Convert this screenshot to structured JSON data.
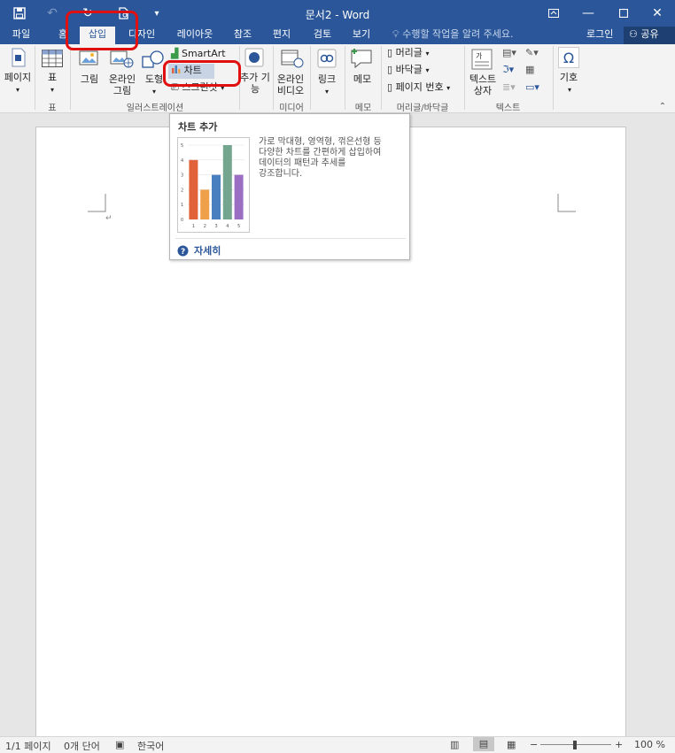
{
  "window": {
    "title": "문서2 - Word",
    "controls": [
      "restore-ribbon",
      "minimize",
      "maximize",
      "close"
    ]
  },
  "qat": [
    "save-icon",
    "undo-icon",
    "redo-icon",
    "print-preview-icon",
    "customize-icon"
  ],
  "tabs": [
    {
      "label": "파일"
    },
    {
      "label": "홈"
    },
    {
      "label": "삽입"
    },
    {
      "label": "디자인"
    },
    {
      "label": "레이아웃"
    },
    {
      "label": "참조"
    },
    {
      "label": "편지"
    },
    {
      "label": "검토"
    },
    {
      "label": "보기"
    }
  ],
  "tell_me": "수행할 작업을 알려 주세요.",
  "login": "로그인",
  "share": "공유",
  "ribbon": {
    "page": "페이지",
    "table": "표",
    "picture": "그림",
    "online_picture_1": "온라인",
    "online_picture_2": "그림",
    "shapes": "도형",
    "smartart": "SmartArt",
    "chart": "차트",
    "screenshot": "스크린샷",
    "addins_1": "추가 기",
    "addins_2": "능",
    "online_video_1": "온라인",
    "online_video_2": "비디오",
    "link": "링크",
    "comment": "메모",
    "header": "머리글",
    "footer": "바닥글",
    "page_number": "페이지 번호",
    "textbox_1": "텍스트",
    "textbox_2": "상자",
    "symbol": "기호",
    "groups": {
      "table": "표",
      "illustrations": "일러스트레이션",
      "media": "미디어",
      "comments": "메모",
      "header_footer": "머리글/바닥글",
      "text": "텍스트"
    }
  },
  "tooltip": {
    "title": "차트 추가",
    "desc_lines": [
      "가로 막대형, 영역형, 꺾은선형 등",
      "다양한 차트를 간편하게 삽입하여",
      "데이터의 패턴과 추세를",
      "강조합니다."
    ],
    "more": "자세히"
  },
  "chart_data": {
    "type": "bar",
    "categories": [
      "1",
      "2",
      "3",
      "4",
      "5"
    ],
    "values": [
      4,
      2,
      3,
      5,
      3
    ],
    "colors": [
      "#e0613a",
      "#f0a04b",
      "#4a7fbf",
      "#74a58e",
      "#9a6fc3"
    ],
    "ylim": [
      0,
      5
    ],
    "yticks": [
      "0",
      "1",
      "2",
      "3",
      "4",
      "5"
    ]
  },
  "status": {
    "page": "1/1 페이지",
    "words": "0개 단어",
    "language": "한국어",
    "zoom": "100 %"
  },
  "colors": {
    "accent": "#2b579a",
    "annotation": "#e01010"
  }
}
